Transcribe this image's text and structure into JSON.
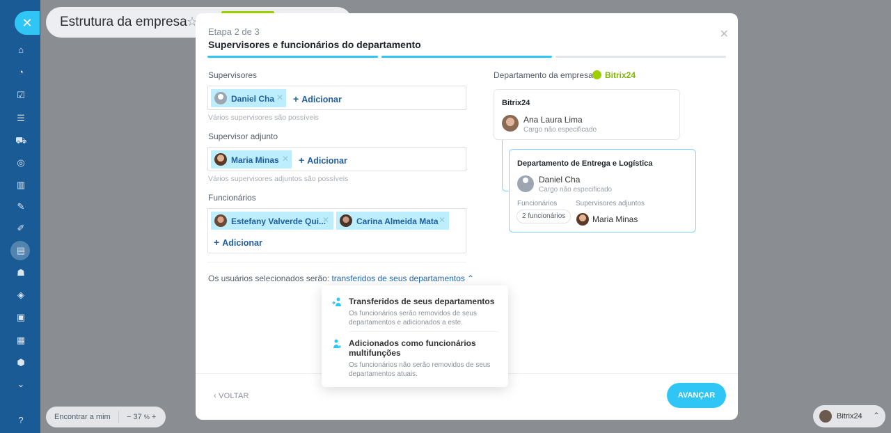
{
  "background": {
    "title": "Estrutura da empresa",
    "find_me": "Encontrar a mim",
    "zoom_minus": "−",
    "zoom_value": "37",
    "zoom_unit": "%",
    "zoom_plus": "+",
    "user_portal": "Bitrix24"
  },
  "modal": {
    "step": "Etapa 2 de 3",
    "title": "Supervisores e funcionários do departamento",
    "supervisors": {
      "label": "Supervisores",
      "tags": [
        "Daniel Cha"
      ],
      "add": "Adicionar",
      "hint": "Vários supervisores são possíveis"
    },
    "deputy": {
      "label": "Supervisor adjunto",
      "tags": [
        "Maria Minas"
      ],
      "add": "Adicionar",
      "hint": "Vários supervisores adjuntos são possíveis"
    },
    "employees": {
      "label": "Funcionários",
      "tags": [
        "Estefany Valverde Qui...",
        "Carina Almeida Mata"
      ],
      "add": "Adicionar"
    },
    "transfer": {
      "prefix": "Os usuários selecionados serão:",
      "link": "transferidos de seus departamentos"
    },
    "menu": [
      {
        "title": "Transferidos de seus departamentos",
        "desc": "Os funcionários serão removidos de seus departamentos e adicionados a este."
      },
      {
        "title": "Adicionados como funcionários multifunções",
        "desc": "Os funcionários não serão removidos de seus departamentos atuais."
      }
    ],
    "org": {
      "label": "Departamento da empresa",
      "badge": "Bitrix24",
      "root": {
        "title": "Bitrix24",
        "name": "Ana Laura Lima",
        "role": "Cargo não especificado"
      },
      "child": {
        "title": "Departamento de Entrega e Logística",
        "name": "Daniel Cha",
        "role": "Cargo não especificado",
        "employees_label": "Funcionários",
        "deputies_label": "Supervisores adjuntos",
        "employees_count": "2 funcionários",
        "deputy_name": "Maria Minas"
      }
    },
    "back": "VOLTAR",
    "next": "AVANÇAR"
  },
  "colors": {
    "accent": "#2fc6f6",
    "sidebar": "#1a5a95",
    "brand_green": "#9dcf00"
  }
}
